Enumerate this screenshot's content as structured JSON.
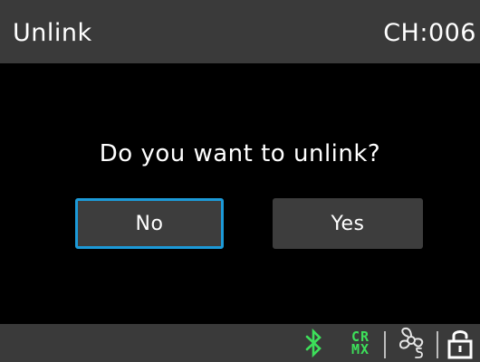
{
  "header": {
    "title": "Unlink",
    "channel": "CH:006"
  },
  "dialog": {
    "prompt": "Do you want to unlink?",
    "no_label": "No",
    "yes_label": "Yes",
    "selected": "No"
  },
  "status_bar": {
    "bluetooth_icon": "bluetooth-icon",
    "crmx_line1": "CR",
    "crmx_line2": "MX",
    "fan_icon": "fan-smart-mode-icon",
    "lock_icon": "unlocked-padlock-icon"
  },
  "colors": {
    "background": "#000000",
    "bar": "#3a3a3a",
    "button": "#3d3d3d",
    "focus": "#1c9ad8",
    "status_green": "#3de05a"
  }
}
